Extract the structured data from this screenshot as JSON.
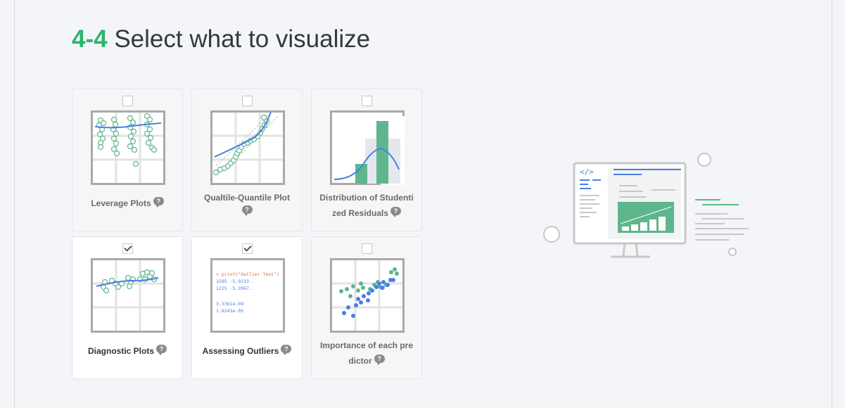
{
  "header": {
    "step": "4-4",
    "title": "Select what to visualize"
  },
  "options": [
    {
      "label_line1": "Leverage Plots",
      "label_line2": "",
      "checked": false
    },
    {
      "label_line1": "Qualtile-Quantile Plot",
      "label_line2": "",
      "checked": false
    },
    {
      "label_line1": "Distribution of Studenti",
      "label_line2": "zed Residuals",
      "checked": false
    },
    {
      "label_line1": "Diagnostic Plots",
      "label_line2": "",
      "checked": true
    },
    {
      "label_line1": "Assessing Outliers",
      "label_line2": "",
      "checked": true
    },
    {
      "label_line1": "Importance of each pre",
      "label_line2": "dictor",
      "checked": false
    }
  ],
  "outliers_thumb": {
    "line1": "> print(\"Outlier Test\")",
    "line2": "1585  -5.9233..",
    "line3": "1225  -5.3967..",
    "line4": "3.3361e-09",
    "line5": "1.9243e-05"
  },
  "help_icon_glyph": "?",
  "colors": {
    "accent_green": "#2db46e",
    "blue": "#4a7ee6",
    "green": "#5fb68c"
  }
}
